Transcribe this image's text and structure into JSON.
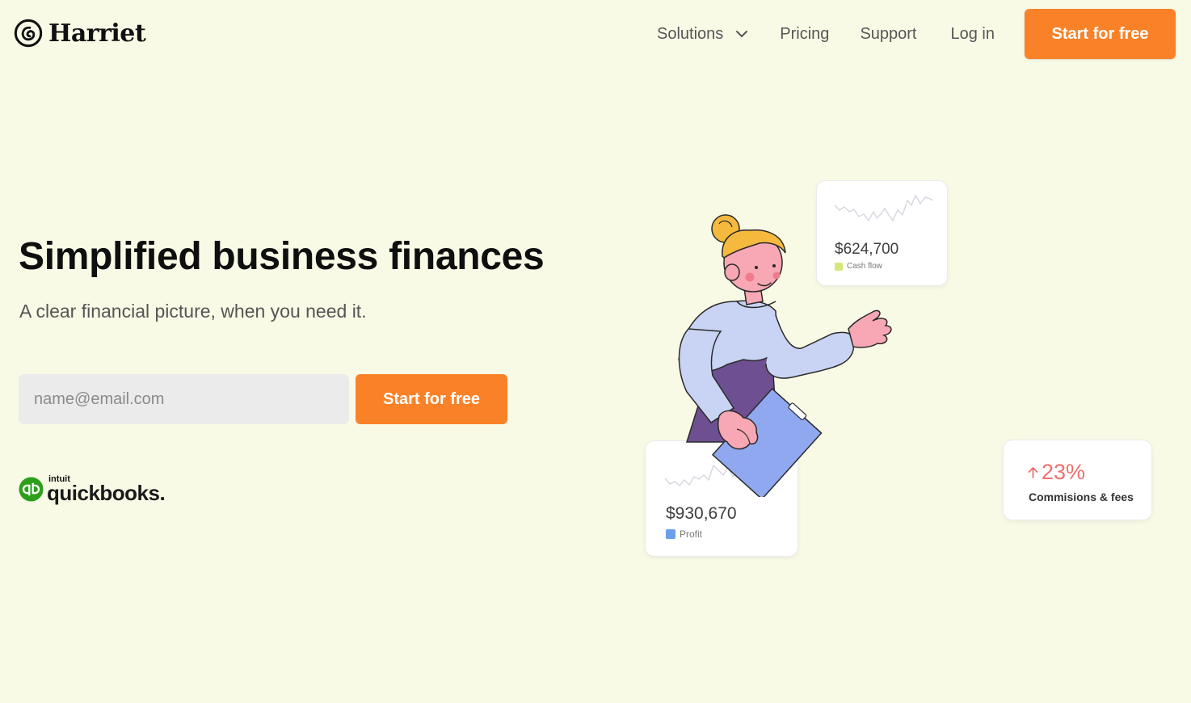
{
  "header": {
    "logo_text": "Harriet",
    "nav": {
      "solutions": "Solutions",
      "pricing": "Pricing",
      "support": "Support",
      "login": "Log in",
      "cta": "Start for free"
    }
  },
  "hero": {
    "title": "Simplified business finances",
    "subtitle": "A clear financial picture, when you need it.",
    "email_placeholder": "name@email.com",
    "email_value": "",
    "cta": "Start for free"
  },
  "partner": {
    "small": "intuit",
    "name": "quickbooks."
  },
  "cards": {
    "cash_flow": {
      "value": "$624,700",
      "label": "Cash flow",
      "swatch_color": "#d4e87a"
    },
    "profit": {
      "value": "$930,670",
      "label": "Profit",
      "swatch_color": "#6aa0ea"
    },
    "commissions": {
      "value": "23%",
      "label": "Commisions & fees",
      "trend": "up",
      "color": "#ef6f6c"
    }
  },
  "icons": {
    "logo": "harriet-logo-icon",
    "solutions_menu": "chevron-down-icon",
    "partner": "quickbooks-icon",
    "trend": "arrow-up-icon"
  },
  "colors": {
    "background": "#f9fae6",
    "accent": "#f98228",
    "input_bg": "#ebebeb"
  }
}
